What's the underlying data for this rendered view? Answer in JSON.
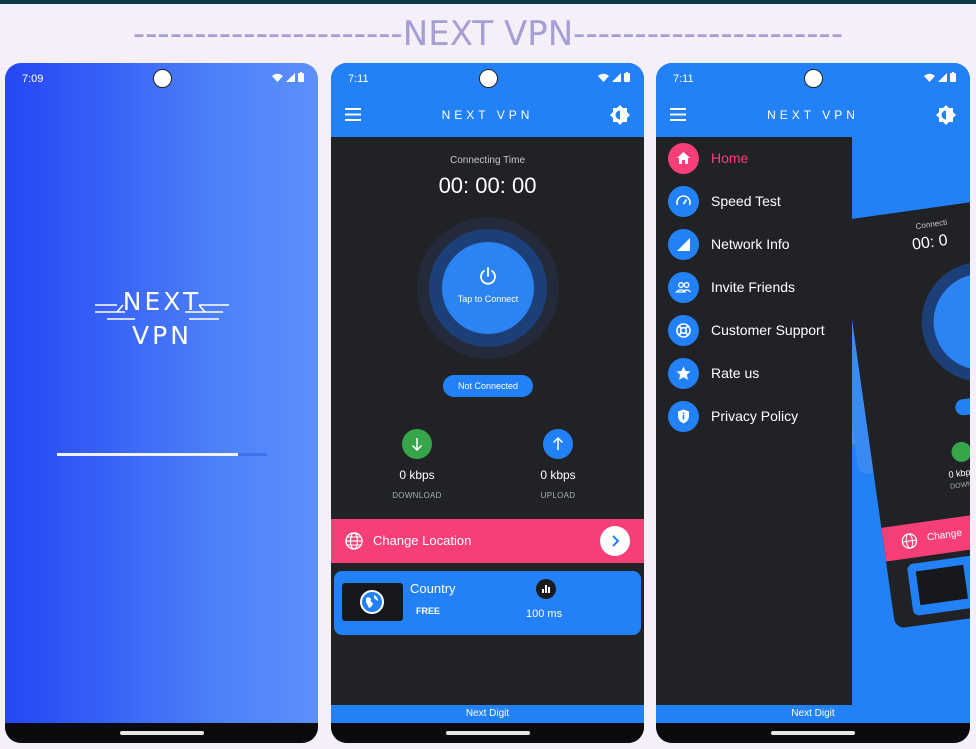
{
  "headline": "----------------------NEXT VPN----------------------",
  "splash": {
    "time": "7:09",
    "logo_line1": "NEXT",
    "logo_line2": "VPN",
    "loading_progress": 0.86
  },
  "home": {
    "time": "7:11",
    "app_title": "NEXT VPN",
    "connecting_label": "Connecting Time",
    "timer": "00: 00: 00",
    "connect_label": "Tap to Connect",
    "status": "Not Connected",
    "download": {
      "value": "0 kbps",
      "caption": "DOWNLOAD",
      "color": "#37a54a"
    },
    "upload": {
      "value": "0 kbps",
      "caption": "UPLOAD",
      "color": "#2281f6"
    },
    "change_location": "Change Location",
    "server": {
      "country": "Country",
      "tier": "FREE",
      "ping": "100 ms"
    },
    "footer": "Next Digit"
  },
  "drawer_screen": {
    "time": "7:11",
    "app_title": "NEXT VPN",
    "items": [
      {
        "label": "Home",
        "icon": "home-icon",
        "active": true
      },
      {
        "label": "Speed Test",
        "icon": "speedometer-icon",
        "active": false
      },
      {
        "label": "Network Info",
        "icon": "signal-icon",
        "active": false
      },
      {
        "label": "Invite Friends",
        "icon": "people-icon",
        "active": false
      },
      {
        "label": "Customer Support",
        "icon": "lifebuoy-icon",
        "active": false
      },
      {
        "label": "Rate us",
        "icon": "star-icon",
        "active": false
      },
      {
        "label": "Privacy Policy",
        "icon": "shield-icon",
        "active": false
      }
    ],
    "bg_connecting": "Connecti",
    "bg_timer": "00: 0",
    "bg_kbps": "0 kbps",
    "bg_download": "DOWNLO",
    "bg_change": "Change",
    "footer": "Next Digit"
  },
  "colors": {
    "accent_blue": "#2281f6",
    "accent_pink": "#f63f78",
    "dark_bg": "#202226"
  }
}
